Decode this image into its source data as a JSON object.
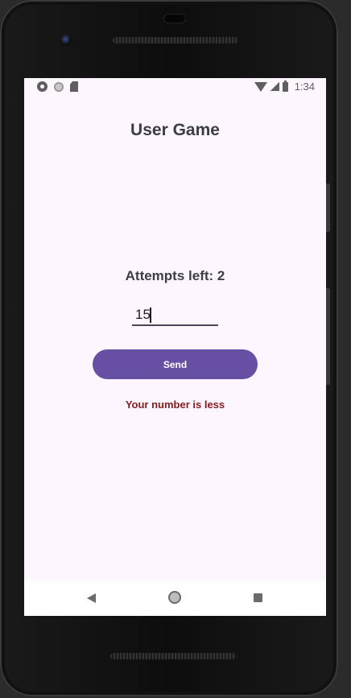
{
  "status_bar": {
    "time": "1:34",
    "left_icons": [
      "gear-icon",
      "circle-icon",
      "sd-card-icon"
    ],
    "right_icons": [
      "wifi-icon",
      "signal-icon",
      "battery-icon"
    ]
  },
  "app": {
    "title": "User Game",
    "attempts_label": "Attempts left: 2",
    "input": {
      "value": "15",
      "placeholder": ""
    },
    "send_label": "Send",
    "result_message": "Your number is less"
  },
  "nav_bar": {
    "icons": [
      "back-icon",
      "home-icon",
      "recents-icon"
    ]
  },
  "colors": {
    "background": "#fdf6ff",
    "primary": "#6750a4",
    "error_text": "#8b1a1a",
    "text": "#3d3d44"
  }
}
